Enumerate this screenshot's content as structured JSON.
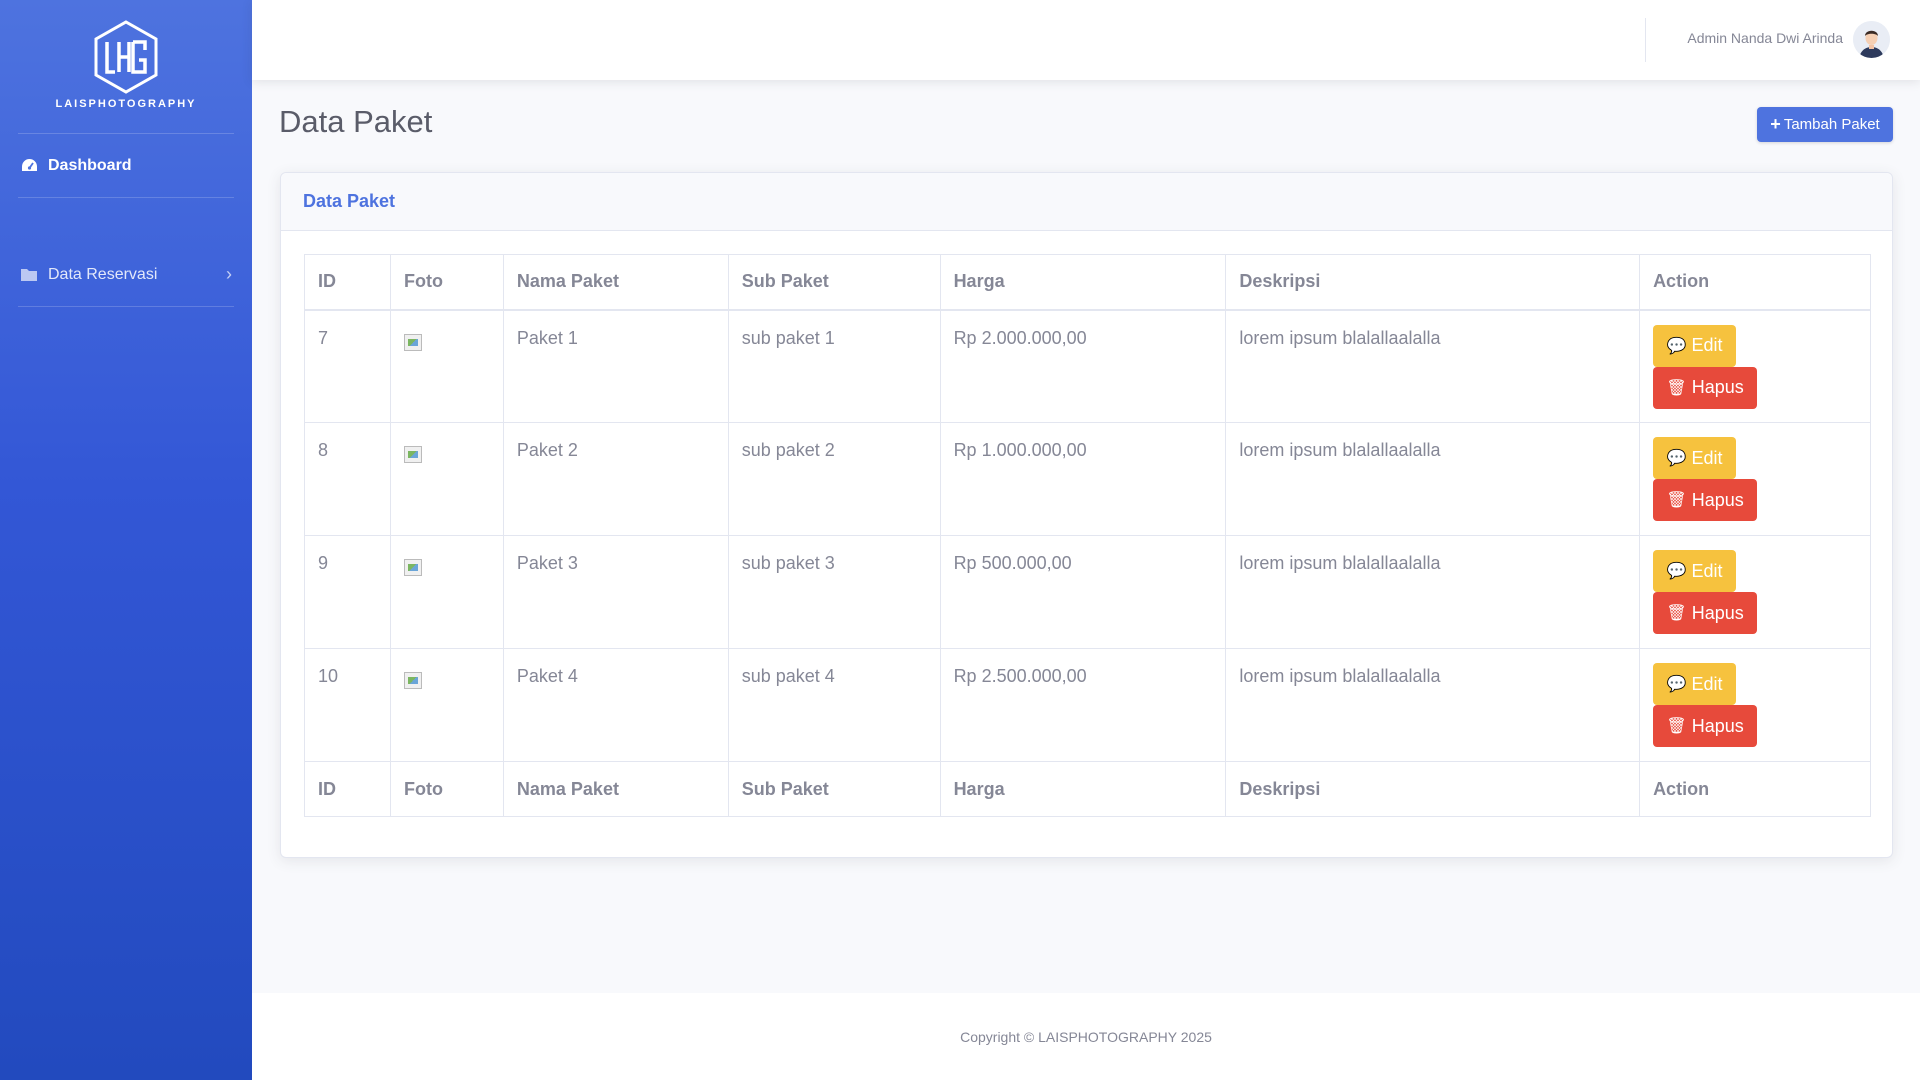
{
  "sidebar": {
    "brand": "LAISPHOTOGRAPHY",
    "items": [
      {
        "label": "Dashboard",
        "icon": "tachometer-icon"
      },
      {
        "label": "Data Reservasi",
        "icon": "folder-icon"
      }
    ]
  },
  "topbar": {
    "user_name": "Admin Nanda Dwi Arinda"
  },
  "page": {
    "title": "Data Paket",
    "add_button": "Tambah Paket"
  },
  "card": {
    "title": "Data Paket"
  },
  "table": {
    "columns": [
      "ID",
      "Foto",
      "Nama Paket",
      "Sub Paket",
      "Harga",
      "Deskripsi",
      "Action"
    ],
    "rows": [
      {
        "id": "7",
        "nama": "Paket 1",
        "sub": "sub paket 1",
        "harga": "Rp 2.000.000,00",
        "deskripsi": "lorem ipsum blalallaalalla"
      },
      {
        "id": "8",
        "nama": "Paket 2",
        "sub": "sub paket 2",
        "harga": "Rp 1.000.000,00",
        "deskripsi": "lorem ipsum blalallaalalla"
      },
      {
        "id": "9",
        "nama": "Paket 3",
        "sub": "sub paket 3",
        "harga": "Rp 500.000,00",
        "deskripsi": "lorem ipsum blalallaalalla"
      },
      {
        "id": "10",
        "nama": "Paket 4",
        "sub": "sub paket 4",
        "harga": "Rp 2.500.000,00",
        "deskripsi": "lorem ipsum blalallaalalla"
      }
    ],
    "edit_label": "Edit",
    "delete_label": "Hapus"
  },
  "footer": {
    "copyright": "Copyright © LAISPHOTOGRAPHY 2025"
  },
  "colors": {
    "primary": "#4e73df",
    "warning": "#f6c23e",
    "danger": "#e74a3b"
  }
}
